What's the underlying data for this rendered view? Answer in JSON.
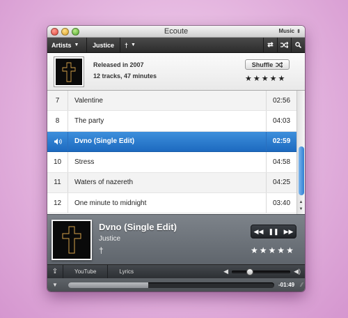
{
  "window": {
    "title": "Ecoute",
    "source_label": "Music"
  },
  "toolbar": {
    "crumbs": {
      "artists": "Artists",
      "artist": "Justice",
      "album": "†"
    },
    "repeat_icon": "repeat-icon",
    "shuffle_icon": "shuffle-icon",
    "search_icon": "search-icon"
  },
  "album": {
    "released": "Released in 2007",
    "summary": "12 tracks, 47 minutes",
    "shuffle_label": "Shuffle",
    "rating_stars": 5
  },
  "tracks": [
    {
      "num": "7",
      "title": "Valentine",
      "duration": "02:56",
      "playing": false
    },
    {
      "num": "8",
      "title": "The party",
      "duration": "04:03",
      "playing": false
    },
    {
      "num": "",
      "title": "Dvno (Single Edit)",
      "duration": "02:59",
      "playing": true
    },
    {
      "num": "10",
      "title": "Stress",
      "duration": "04:58",
      "playing": false
    },
    {
      "num": "11",
      "title": "Waters of nazereth",
      "duration": "04:25",
      "playing": false
    },
    {
      "num": "12",
      "title": "One minute to midnight",
      "duration": "03:40",
      "playing": false
    }
  ],
  "now_playing": {
    "title": "Dvno (Single Edit)",
    "artist": "Justice",
    "album": "†",
    "rating_stars": 5
  },
  "bottom": {
    "tabs": [
      "YouTube",
      "Lyrics"
    ],
    "volume_fraction": 0.31,
    "progress_fraction": 0.39,
    "remaining": "-01:49"
  },
  "colors": {
    "selection": "#1d6ac0",
    "cross": "#d6a24a"
  }
}
